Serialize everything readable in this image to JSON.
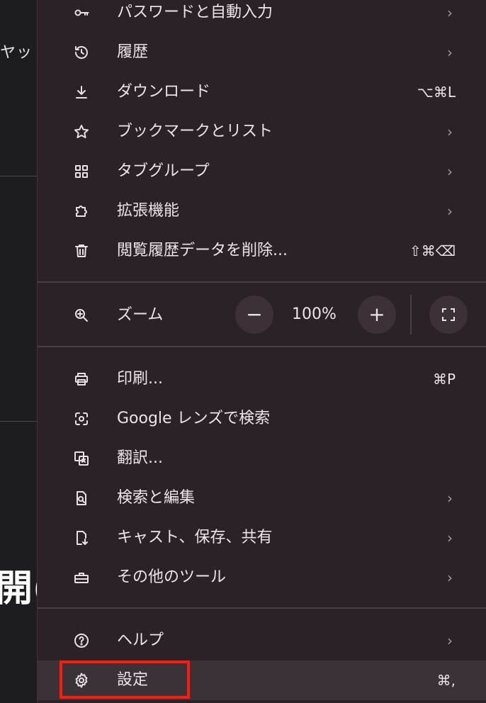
{
  "background": {
    "small_text": "ヤッ",
    "large_text": "開("
  },
  "menu": {
    "items": [
      {
        "key": "passwords",
        "label": "パスワードと自動入力",
        "chevron": "›"
      },
      {
        "key": "history",
        "label": "履歴",
        "chevron": "›"
      },
      {
        "key": "downloads",
        "label": "ダウンロード",
        "shortcut": "⌥⌘L"
      },
      {
        "key": "bookmarks",
        "label": "ブックマークとリスト",
        "chevron": "›"
      },
      {
        "key": "tab-groups",
        "label": "タブグループ",
        "chevron": "›"
      },
      {
        "key": "extensions",
        "label": "拡張機能",
        "chevron": "›"
      },
      {
        "key": "clear-data",
        "label": "閲覧履歴データを削除...",
        "shortcut": "⇧⌘⌫"
      }
    ],
    "zoom": {
      "label": "ズーム",
      "minus": "−",
      "value": "100%",
      "plus": "+"
    },
    "items2": [
      {
        "key": "print",
        "label": "印刷...",
        "shortcut": "⌘P"
      },
      {
        "key": "google-lens",
        "label": "Google レンズで検索"
      },
      {
        "key": "translate",
        "label": "翻訳..."
      },
      {
        "key": "find-edit",
        "label": "検索と編集",
        "chevron": "›"
      },
      {
        "key": "cast-save-share",
        "label": "キャスト、保存、共有",
        "chevron": "›"
      },
      {
        "key": "more-tools",
        "label": "その他のツール",
        "chevron": "›"
      }
    ],
    "items3": [
      {
        "key": "help",
        "label": "ヘルプ",
        "chevron": "›"
      },
      {
        "key": "settings",
        "label": "設定",
        "shortcut": "⌘,"
      }
    ]
  },
  "icons": {
    "passwords": "key-icon",
    "history": "history-icon",
    "downloads": "download-icon",
    "bookmarks": "star-icon",
    "tab_groups": "grid-icon",
    "extensions": "puzzle-icon",
    "clear_data": "trash-icon",
    "zoom": "zoom-in-icon",
    "fullscreen": "fullscreen-icon",
    "print": "printer-icon",
    "google_lens": "lens-icon",
    "translate": "translate-icon",
    "find_edit": "find-page-icon",
    "cast": "cast-save-icon",
    "more_tools": "toolbox-icon",
    "help": "help-icon",
    "settings": "gear-icon"
  },
  "colors": {
    "menu_bg": "#2a2227",
    "text": "#ebe4e8",
    "highlight": "#ff1a0a"
  }
}
